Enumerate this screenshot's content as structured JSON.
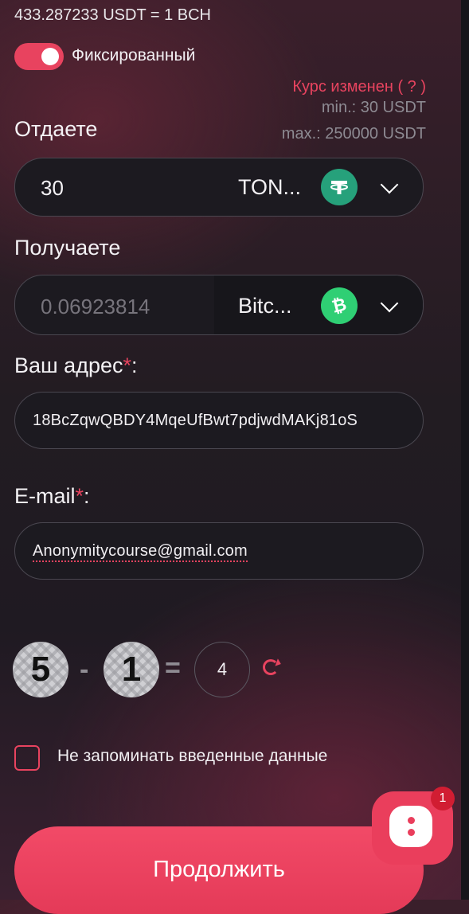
{
  "rate": {
    "text": "433.287233 USDT = 1 BCH"
  },
  "toggle": {
    "label": "Фиксированный",
    "on": true
  },
  "rate_changed": {
    "text": "Курс изменен",
    "hint": "( ? )"
  },
  "limits": {
    "min": "min.: 30 USDT",
    "max": "max.: 250000 USDT"
  },
  "send": {
    "label": "Отдаете",
    "amount": "30",
    "currency": "TON...",
    "icon": "tether-icon",
    "color": "#26a17b"
  },
  "receive": {
    "label": "Получаете",
    "amount": "0.06923814",
    "currency": "Bitc...",
    "icon": "bitcoin-cash-icon",
    "color": "#2fcf74"
  },
  "address": {
    "label": "Ваш адрес",
    "required_mark": "*",
    "colon": ":",
    "value": "18BcZqwQBDY4MqeUfBwt7pdjwdMAKj81oS"
  },
  "email": {
    "label": "E-mail",
    "required_mark": "*",
    "colon": ":",
    "value": "Anonymitycourse@gmail.com"
  },
  "captcha": {
    "a": "5",
    "op": "-",
    "b": "1",
    "eq": "=",
    "answer": "4"
  },
  "remember": {
    "label": "Не запоминать введенные данные"
  },
  "submit": {
    "label": "Продолжить"
  },
  "chat": {
    "badge": "1"
  },
  "colors": {
    "accent": "#e8435f"
  }
}
